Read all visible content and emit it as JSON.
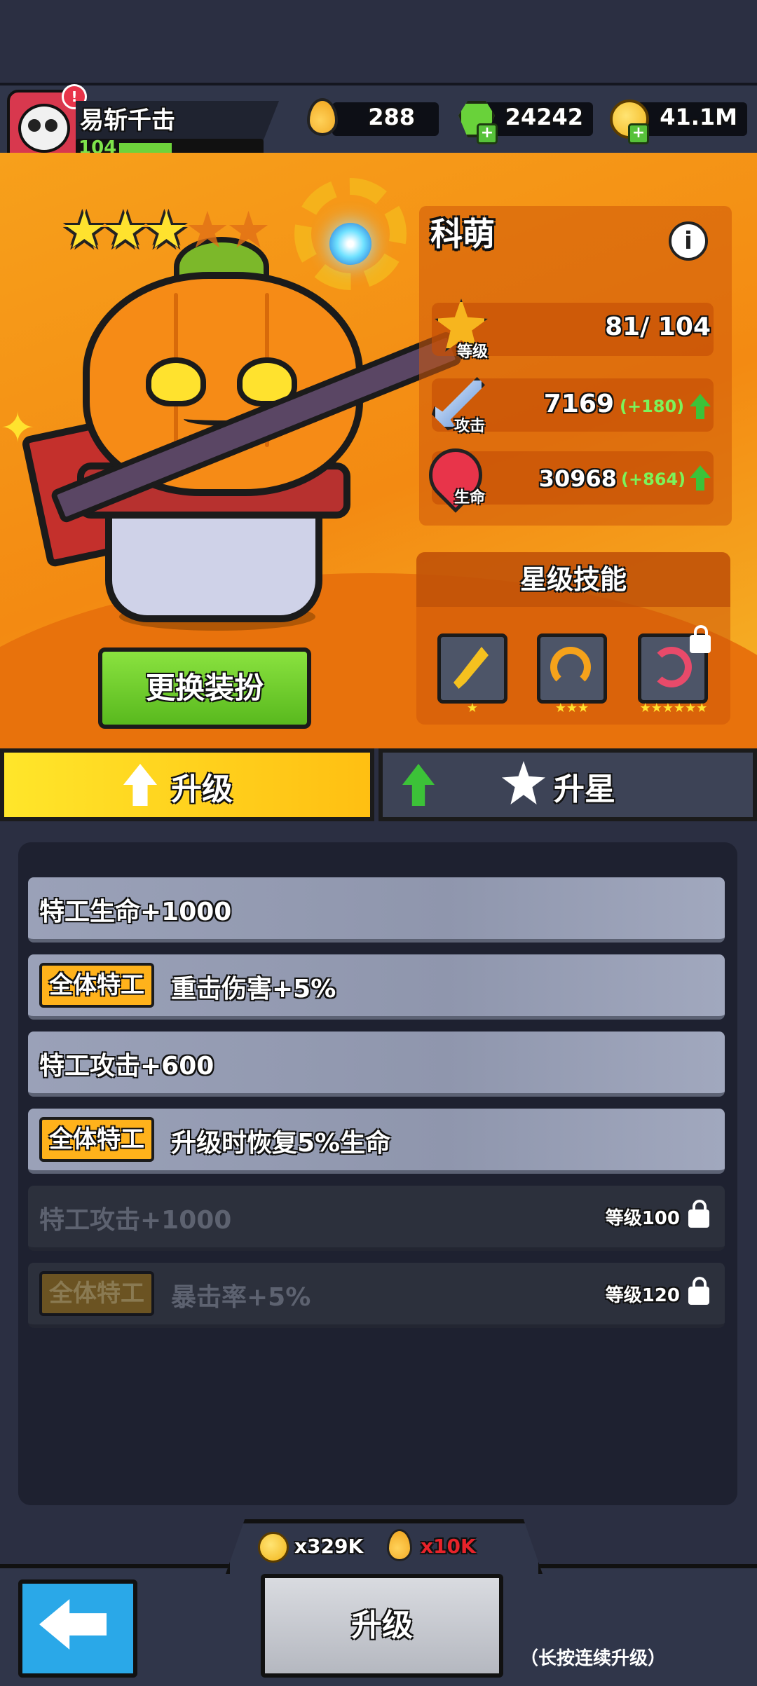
{
  "player": {
    "name": "易斩千击",
    "level": "104",
    "alert": "!",
    "xp_progress": 0.3
  },
  "currencies": [
    {
      "icon": "gold-drop-icon",
      "value": "288"
    },
    {
      "icon": "green-gem-icon",
      "value": "24242"
    },
    {
      "icon": "gold-coin-icon",
      "value": "41.1M"
    }
  ],
  "hero": {
    "name": "科萌",
    "stars_total": 5,
    "stars_filled": 3,
    "info_label": "i",
    "stats": [
      {
        "icon": "level-star-icon",
        "tag": "等级",
        "value": "81/ 104",
        "bonus": ""
      },
      {
        "icon": "sword-attack-icon",
        "tag": "攻击",
        "value": "7169",
        "bonus": "(+180)"
      },
      {
        "icon": "heart-life-icon",
        "tag": "生命",
        "value": "30968",
        "bonus": "(+864)"
      }
    ],
    "skills_title": "星级技能",
    "skills": [
      {
        "icon": "sword-plus-skill-icon",
        "stars": "★"
      },
      {
        "icon": "bow-plus-skill-icon",
        "stars": "★★★"
      },
      {
        "icon": "swirl-skill-icon",
        "stars": "★★★★★★",
        "locked": true
      }
    ],
    "outfit_button": "更换装扮"
  },
  "tabs": {
    "upgrade": "升级",
    "star_up": "升星"
  },
  "upgrade_list": [
    {
      "tag": "",
      "text": "特工生命+1000",
      "locked": false,
      "req": ""
    },
    {
      "tag": "全体特工",
      "text": "重击伤害+5%",
      "locked": false,
      "req": ""
    },
    {
      "tag": "",
      "text": "特工攻击+600",
      "locked": false,
      "req": ""
    },
    {
      "tag": "全体特工",
      "text": "升级时恢复5%生命",
      "locked": false,
      "req": ""
    },
    {
      "tag": "",
      "text": "特工攻击+1000",
      "locked": true,
      "req": "等级100"
    },
    {
      "tag": "全体特工",
      "text": "暴击率+5%",
      "locked": true,
      "req": "等级120"
    }
  ],
  "cost": {
    "coins": "x329K",
    "drops": "x10K",
    "drops_color": "#e8232a"
  },
  "upgrade_button": "升级",
  "hint": "（长按连续升级）",
  "colors": {
    "accent_orange": "#f38a12",
    "tab_active": "#ffd21f",
    "button_green": "#6fcf2a",
    "back_blue": "#2aa8e8",
    "bonus_green": "#7cf35a"
  }
}
